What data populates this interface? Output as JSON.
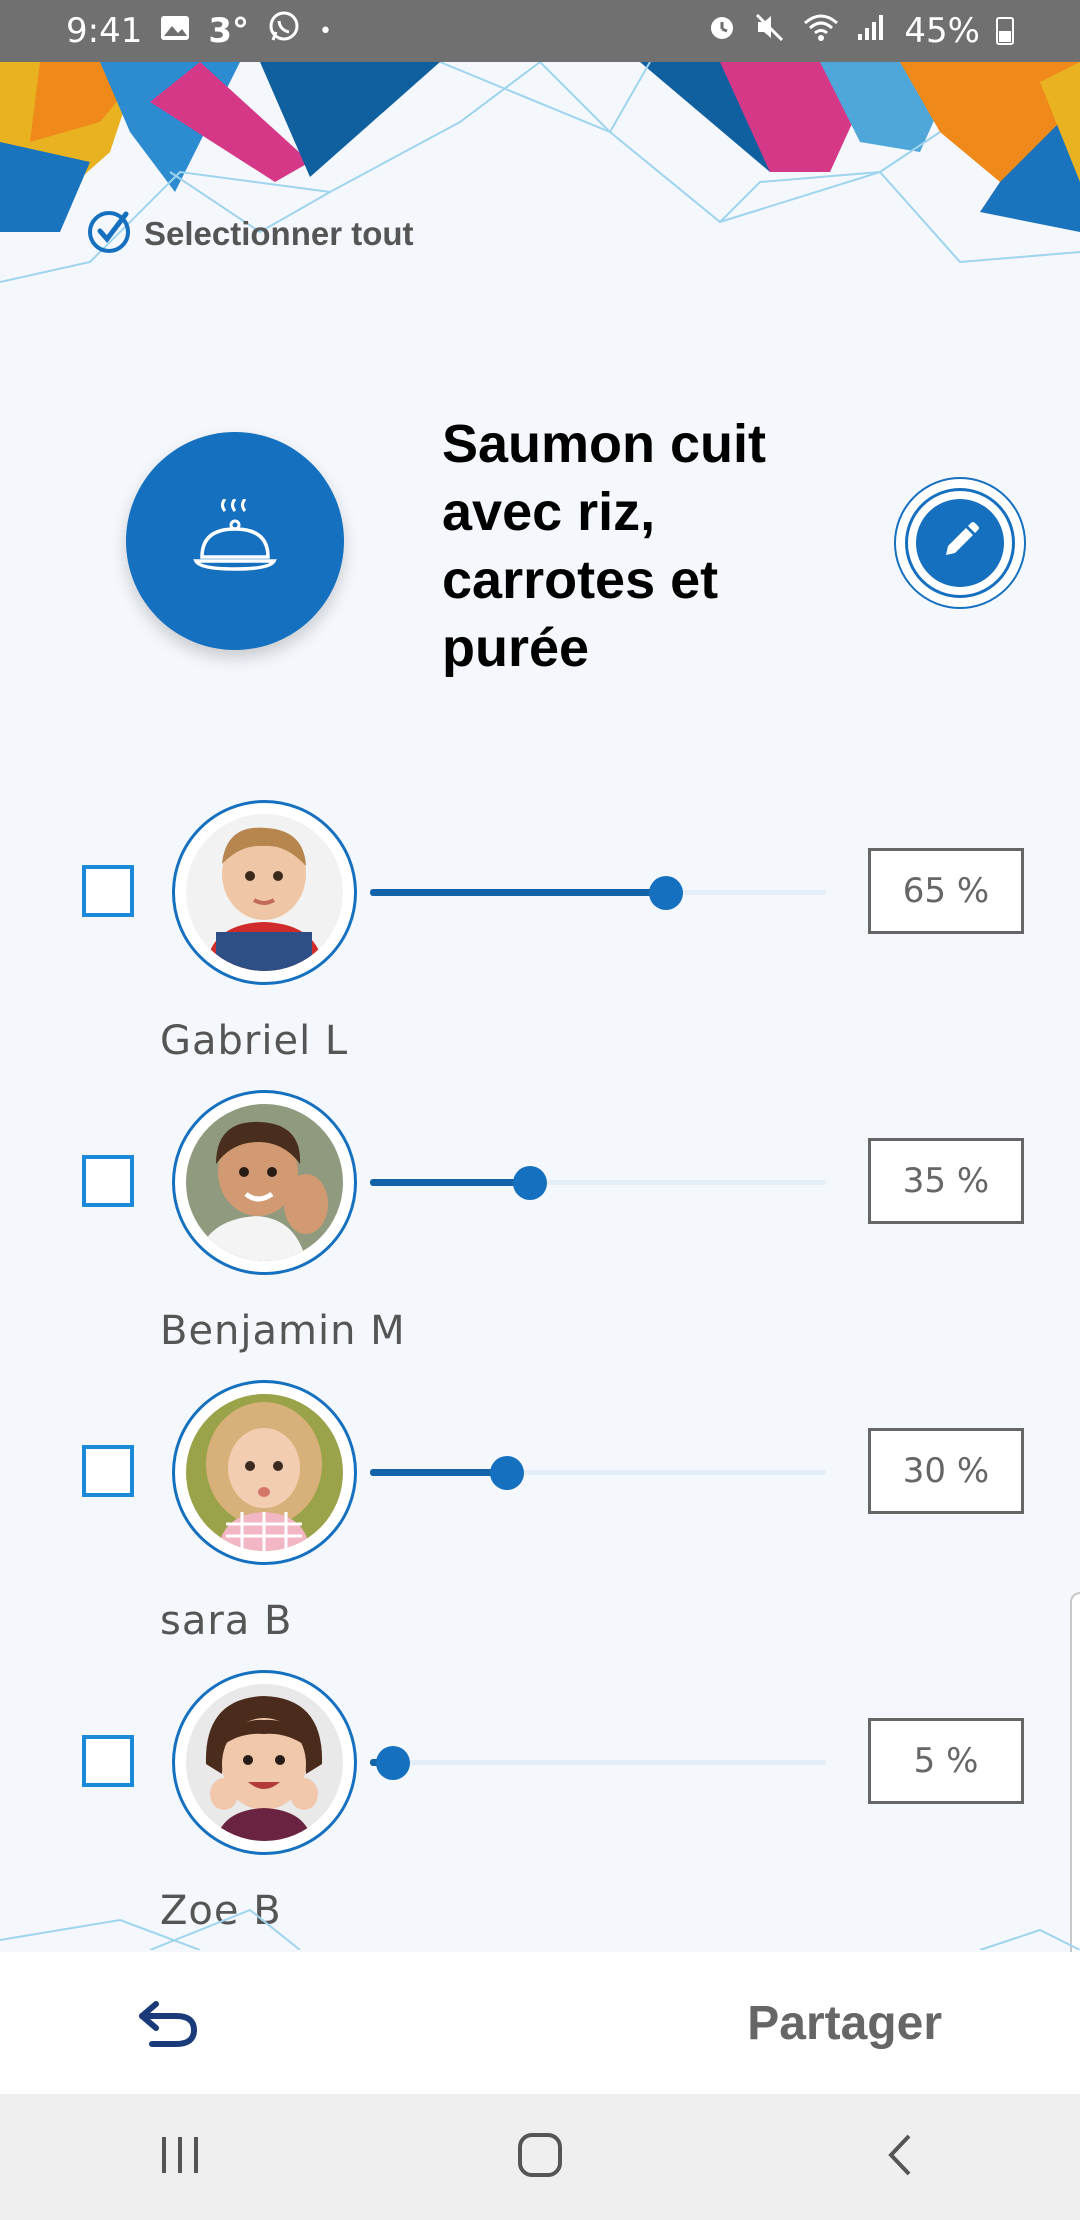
{
  "status_bar": {
    "time": "9:41",
    "temperature": "3°",
    "dot": "•",
    "battery": "45%"
  },
  "header": {
    "select_all_label": "Selectionner tout"
  },
  "meal": {
    "title": "Saumon cuit avec riz, carrotes et purée",
    "icon": "cloche-icon"
  },
  "children": [
    {
      "name": "Gabriel L",
      "percent_label": "65 %",
      "portion": 0.65
    },
    {
      "name": "Benjamin M",
      "percent_label": "35 %",
      "portion": 0.35
    },
    {
      "name": "sara B",
      "percent_label": "30 %",
      "portion": 0.3
    },
    {
      "name": "Zoe B",
      "percent_label": "5 %",
      "portion": 0.05
    }
  ],
  "action_bar": {
    "share_label": "Partager"
  },
  "colors": {
    "accent": "#1570bf",
    "checkbox": "#1a8ad8",
    "background": "#f4f8fd"
  }
}
